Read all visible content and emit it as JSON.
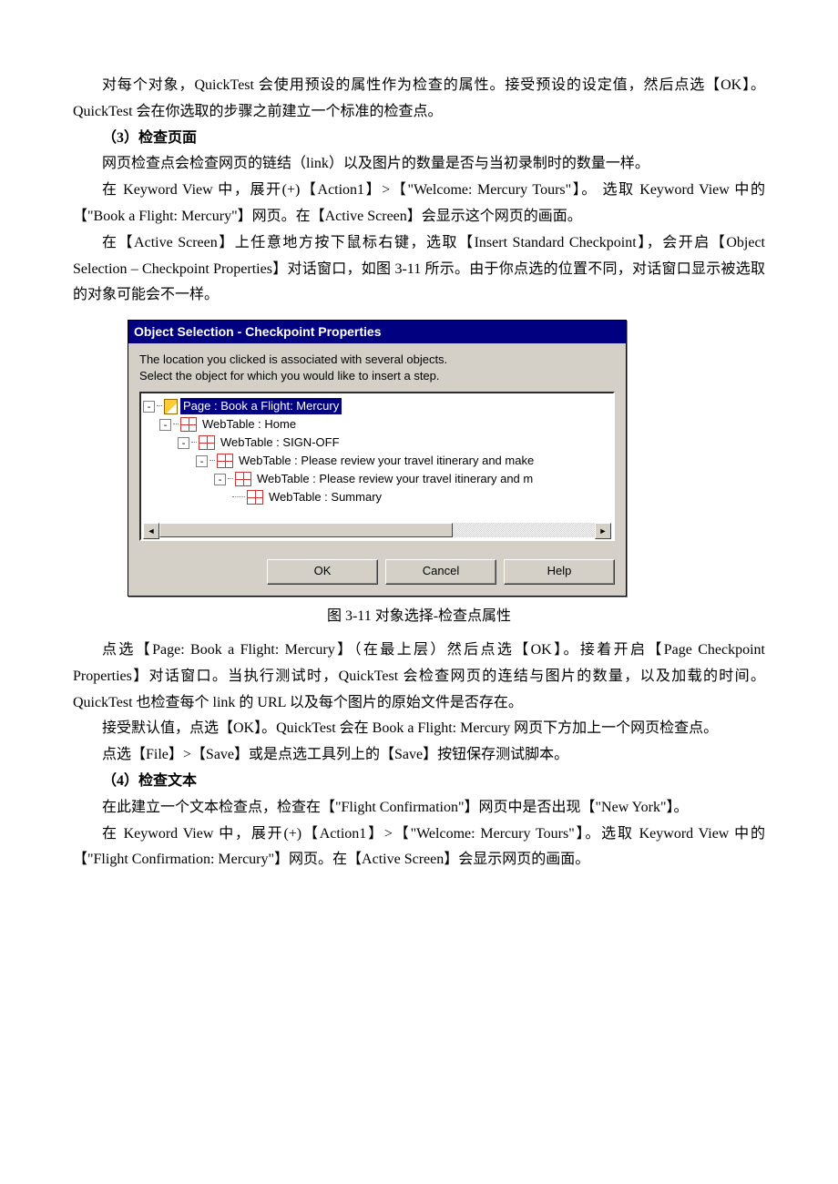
{
  "paragraphs": {
    "p1": "对每个对象，QuickTest 会使用预设的属性作为检查的属性。接受预设的设定值，然后点选【OK】。QuickTest 会在你选取的步骤之前建立一个标准的检查点。",
    "h3": "（3）检查页面",
    "p2": "网页检查点会检查网页的链结（link）以及图片的数量是否与当初录制时的数量一样。",
    "p3": "在 Keyword View 中，展开(+)【Action1】>【\"Welcome: Mercury Tours\"】。 选取 Keyword View 中的【\"Book a Flight: Mercury\"】网页。在【Active Screen】会显示这个网页的画面。",
    "p4": "在【Active Screen】上任意地方按下鼠标右键，选取【Insert Standard Checkpoint】，会开启【Object Selection – Checkpoint Properties】对话窗口，如图 3-11 所示。由于你点选的位置不同，对话窗口显示被选取的对象可能会不一样。",
    "caption": "图 3-11 对象选择-检查点属性",
    "p5": "点选【Page: Book a Flight: Mercury】（在最上层）然后点选【OK】。接着开启【Page Checkpoint Properties】对话窗口。当执行测试时，QuickTest 会检查网页的连结与图片的数量，以及加载的时间。QuickTest 也检查每个 link 的 URL 以及每个图片的原始文件是否存在。",
    "p6": "接受默认值，点选【OK】。QuickTest 会在 Book a Flight: Mercury 网页下方加上一个网页检查点。",
    "p7": "点选【File】>【Save】或是点选工具列上的【Save】按钮保存测试脚本。",
    "h4": "（4）检查文本",
    "p8": "在此建立一个文本检查点，检查在【\"Flight Confirmation\"】网页中是否出现【\"New York\"】。",
    "p9": "在 Keyword View 中，展开(+)【Action1】>【\"Welcome: Mercury Tours\"】。选取 Keyword View 中的【\"Flight Confirmation: Mercury\"】网页。在【Active Screen】会显示网页的画面。"
  },
  "dialog": {
    "title": "Object Selection - Checkpoint Properties",
    "line1": "The location you clicked is associated with several objects.",
    "line2": "Select the object for which you would like to insert a step.",
    "tree": {
      "n0": "Page : Book a Flight: Mercury",
      "n1": "WebTable : Home",
      "n2": "WebTable : SIGN-OFF",
      "n3": "WebTable : Please review your travel itinerary and make",
      "n4": "WebTable : Please review your travel itinerary and m",
      "n5": "WebTable : Summary"
    },
    "buttons": {
      "ok": "OK",
      "cancel": "Cancel",
      "help": "Help"
    }
  }
}
